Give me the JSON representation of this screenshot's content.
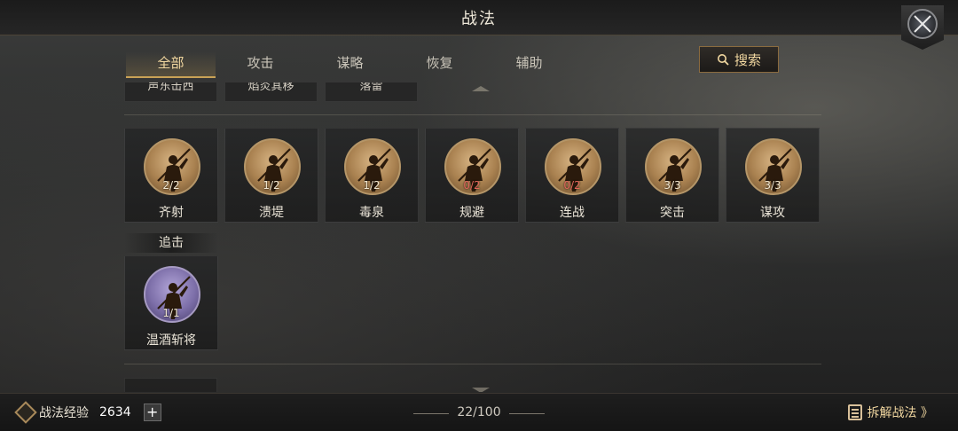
{
  "header": {
    "title": "战法"
  },
  "tabs": [
    {
      "label": "全部",
      "active": true
    },
    {
      "label": "攻击",
      "active": false
    },
    {
      "label": "谋略",
      "active": false
    },
    {
      "label": "恢复",
      "active": false
    },
    {
      "label": "辅助",
      "active": false
    }
  ],
  "search": {
    "label": "搜索"
  },
  "partial_row": [
    "声东击西",
    "焰炎其移",
    "落雷"
  ],
  "cards_row1": [
    {
      "name": "齐射",
      "count": "2/2",
      "count_state": "normal"
    },
    {
      "name": "溃堤",
      "count": "1/2",
      "count_state": "normal"
    },
    {
      "name": "毒泉",
      "count": "1/2",
      "count_state": "normal"
    },
    {
      "name": "规避",
      "count": "0/2",
      "count_state": "empty"
    },
    {
      "name": "连战",
      "count": "0/2",
      "count_state": "empty"
    },
    {
      "name": "突击",
      "count": "3/3",
      "count_state": "normal"
    },
    {
      "name": "谋攻",
      "count": "3/3",
      "count_state": "normal"
    }
  ],
  "section_pursuit": {
    "label": "追击"
  },
  "cards_pursuit": [
    {
      "name": "温酒斩将",
      "count": "1/1",
      "count_state": "normal",
      "rarity": "purple"
    }
  ],
  "footer": {
    "exp_label": "战法经验",
    "exp_value": "2634",
    "plus": "+",
    "page_count": "22/100",
    "dismantle_label": "拆解战法 》"
  },
  "colors": {
    "accent": "#c9a256",
    "empty_count": "#e0655a"
  }
}
